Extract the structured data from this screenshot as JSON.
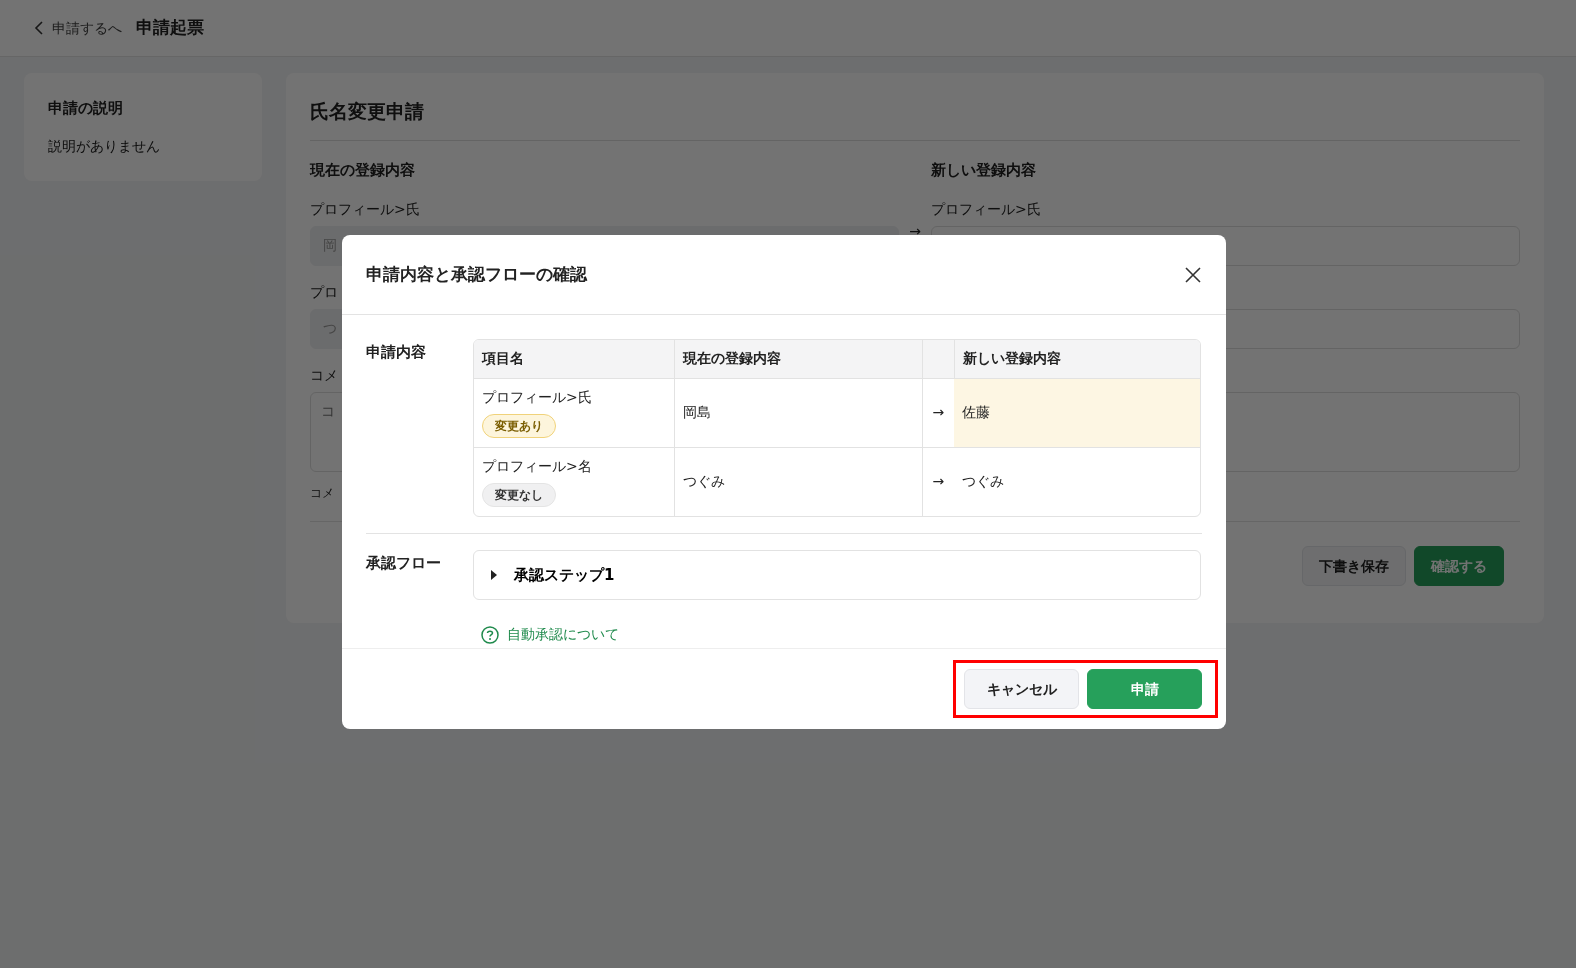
{
  "header": {
    "back_link": "申請するへ",
    "title": "申請起票"
  },
  "sidebar": {
    "title": "申請の説明",
    "text": "説明がありません"
  },
  "form": {
    "title": "氏名変更申請",
    "current_heading": "現在の登録内容",
    "new_heading": "新しい登録内容",
    "fields": [
      {
        "current_label": "プロフィール>氏",
        "current_value": "岡",
        "arrow": "→",
        "new_label": "プロフィール>氏"
      },
      {
        "current_label": "プロ",
        "current_value": "つ"
      }
    ],
    "comment": {
      "label": "コメ",
      "placeholder": "コ",
      "help": "コメ"
    },
    "buttons": [
      {
        "label": "下書き保存",
        "kind": "secondary"
      },
      {
        "label": "確認する",
        "kind": "primary"
      }
    ]
  },
  "dialog": {
    "title": "申請内容と承認フローの確認",
    "content_label": "申請内容",
    "table": {
      "columns": [
        "項目名",
        "現在の登録内容",
        "新しい登録内容"
      ],
      "rows": [
        {
          "item": "プロフィール>氏",
          "badge": "変更あり",
          "changed": true,
          "current": "岡島",
          "arrow": "→",
          "new": "佐藤"
        },
        {
          "item": "プロフィール>名",
          "badge": "変更なし",
          "changed": false,
          "current": "つぐみ",
          "arrow": "→",
          "new": "つぐみ"
        }
      ]
    },
    "flow_label": "承認フロー",
    "steps": [
      {
        "label": "承認ステップ1",
        "expanded": false
      }
    ],
    "help_link": "自動承認について",
    "buttons": [
      {
        "label": "キャンセル",
        "kind": "secondary"
      },
      {
        "label": "申請",
        "kind": "primary"
      }
    ],
    "buttons_highlighted": true
  }
}
